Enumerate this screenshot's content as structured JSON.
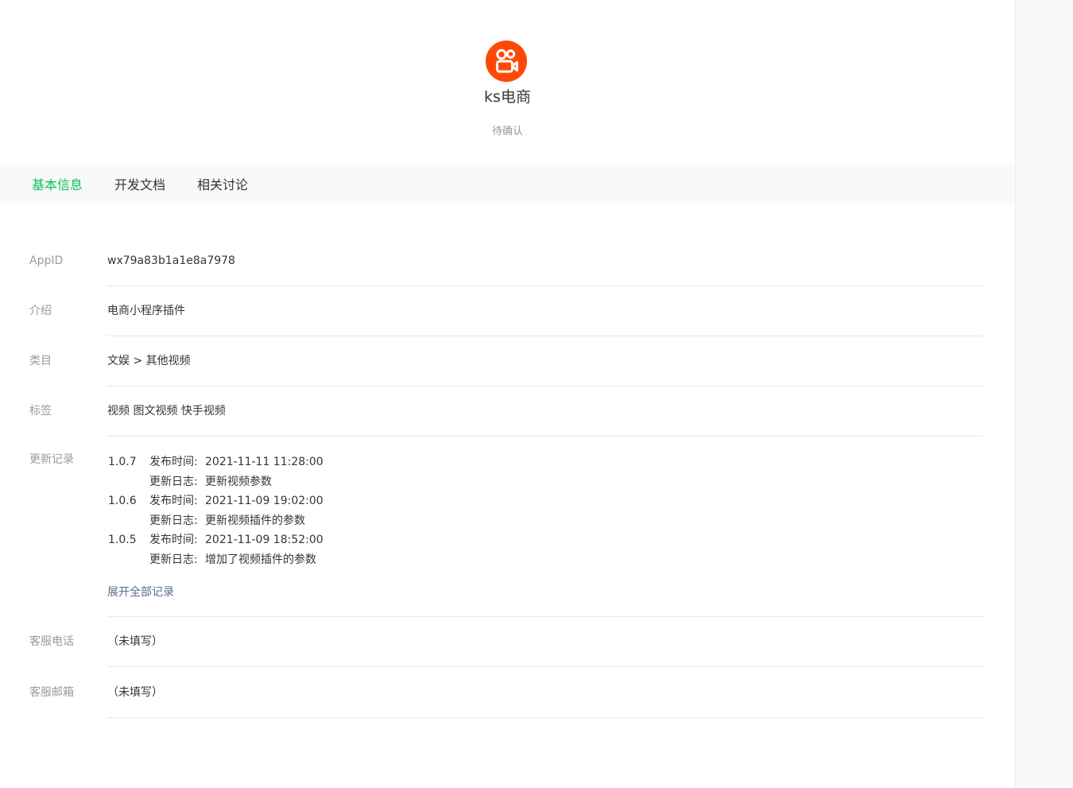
{
  "app": {
    "name": "ks电商",
    "status": "待确认",
    "logo_icon": "kuaishou-camera-icon",
    "logo_color": "#fe4906"
  },
  "tabs": [
    {
      "label": "基本信息",
      "active": true
    },
    {
      "label": "开发文档",
      "active": false
    },
    {
      "label": "相关讨论",
      "active": false
    }
  ],
  "accent_color": "#07c160",
  "info": {
    "appid": {
      "label": "AppID",
      "value": "wx79a83b1a1e8a7978"
    },
    "intro": {
      "label": "介绍",
      "value": "电商小程序插件"
    },
    "category": {
      "label": "类目",
      "value": "文娱 > 其他视频"
    },
    "tags": {
      "label": "标签",
      "value": "视频 图文视频 快手视频"
    },
    "changelog": {
      "label": "更新记录",
      "time_key": "发布时间:",
      "log_key": "更新日志:",
      "entries": [
        {
          "version": "1.0.7",
          "time": "2021-11-11 11:28:00",
          "log": "更新视频参数"
        },
        {
          "version": "1.0.6",
          "time": "2021-11-09 19:02:00",
          "log": "更新视频插件的参数"
        },
        {
          "version": "1.0.5",
          "time": "2021-11-09 18:52:00",
          "log": "增加了视频插件的参数"
        }
      ],
      "expand_label": "展开全部记录"
    },
    "phone": {
      "label": "客服电话",
      "value": "（未填写）"
    },
    "email": {
      "label": "客服邮箱",
      "value": "（未填写）"
    }
  }
}
